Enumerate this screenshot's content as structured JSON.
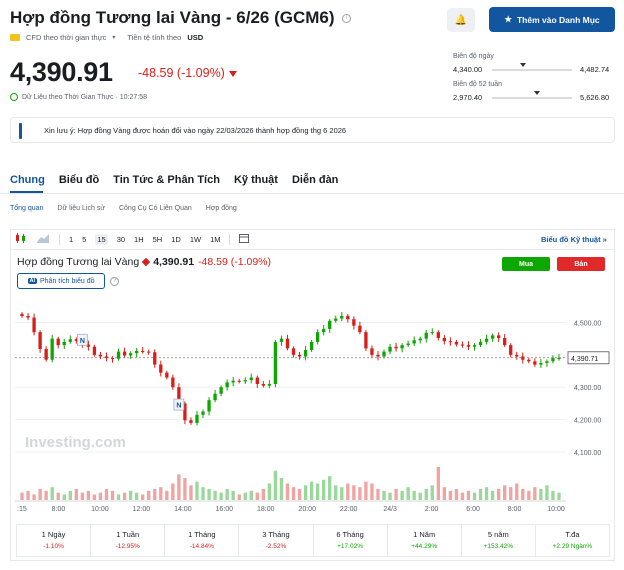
{
  "header": {
    "title": "Hợp đồng Tương lai Vàng - 6/26 (GCM6)",
    "info_glyph": "i",
    "cfd_label": "CFD theo thời gian thực",
    "currency_label": "Tiền tệ tính theo",
    "currency": "USD",
    "watchlist_button": "Thêm vào Danh Mục",
    "star_glyph": "★",
    "alert_glyph": "🔔"
  },
  "quote": {
    "price": "4,390.91",
    "change": "-48.59 (-1.09%)",
    "realtime_label": "Dữ Liệu theo Thời Gian Thực · 10:27:58"
  },
  "ranges": {
    "day_label": "Biên độ ngày",
    "day_low": "4,340.00",
    "day_high": "4,482.74",
    "day_position": 0.35,
    "week52_label": "Biên độ 52 tuần",
    "week52_low": "2,970.40",
    "week52_high": "5,626.80",
    "week52_position": 0.53
  },
  "notice": {
    "text": "Xin lưu ý: Hợp đồng Vàng được hoán đổi vào ngày 22/03/2026 thành hợp đồng thg 6 2026"
  },
  "tabs": [
    "Chung",
    "Biểu đồ",
    "Tin Tức & Phân Tích",
    "Kỹ thuật",
    "Diễn đàn"
  ],
  "subtabs": [
    "Tổng quan",
    "Dữ liệu Lịch sử",
    "Công Cụ Có Liên Quan",
    "Hợp đồng"
  ],
  "toolbar": {
    "intervals": [
      "1",
      "5",
      "15",
      "30",
      "1H",
      "5H",
      "1D",
      "1W",
      "1M"
    ],
    "active_interval": "15",
    "tech_chart_link": "Biểu đồ Kỹ thuật »"
  },
  "instrument": {
    "name": "Hợp đồng Tương lai Vàng",
    "price": "4,390.91",
    "change": "-48.59 (-1.09%)",
    "buy_label": "Mua",
    "sell_label": "Bán",
    "analysis_label": "Phân tích biểu đồ",
    "ai_badge": "AI",
    "help_glyph": "?"
  },
  "chart_data": {
    "type": "candlestick",
    "watermark": "Investing.com",
    "x_ticks": [
      ":15",
      "8:00",
      "10:00",
      "12:00",
      "14:00",
      "16:00",
      "18:00",
      "20:00",
      "22:00",
      "24/3",
      "2:00",
      "6:00",
      "8:00",
      "10:00"
    ],
    "y_ticks": [
      4500,
      4400,
      4300,
      4200,
      4100
    ],
    "y_tick_labels": [
      "4,500.00",
      "4,400.00",
      "4,300.00",
      "4,200.00",
      "4,100.00"
    ],
    "ylim": [
      4060,
      4560
    ],
    "last_price": 4390.91,
    "last_label": "4,390.71",
    "markers": [
      {
        "label": "N",
        "index": 10,
        "price": 4445
      },
      {
        "label": "N",
        "index": 26,
        "price": 4245
      }
    ],
    "closes": [
      4520,
      4515,
      4470,
      4418,
      4385,
      4450,
      4430,
      4440,
      4448,
      4443,
      4432,
      4425,
      4400,
      4395,
      4390,
      4388,
      4410,
      4398,
      4405,
      4412,
      4410,
      4408,
      4370,
      4345,
      4330,
      4300,
      4250,
      4198,
      4190,
      4215,
      4225,
      4260,
      4280,
      4300,
      4315,
      4320,
      4318,
      4322,
      4330,
      4310,
      4305,
      4310,
      4440,
      4450,
      4420,
      4400,
      4395,
      4415,
      4440,
      4470,
      4480,
      4505,
      4512,
      4520,
      4510,
      4490,
      4470,
      4420,
      4400,
      4395,
      4410,
      4425,
      4420,
      4430,
      4435,
      4445,
      4450,
      4468,
      4470,
      4452,
      4442,
      4440,
      4432,
      4430,
      4425,
      4430,
      4440,
      4450,
      4460,
      4452,
      4430,
      4400,
      4395,
      4385,
      4380,
      4370,
      4375,
      4380,
      4390,
      4390
    ],
    "volumes": [
      4,
      5,
      3,
      6,
      5,
      7,
      4,
      3,
      5,
      6,
      4,
      5,
      3,
      4,
      6,
      5,
      3,
      4,
      5,
      4,
      3,
      5,
      6,
      7,
      5,
      9,
      14,
      12,
      8,
      10,
      7,
      6,
      5,
      4,
      6,
      5,
      3,
      4,
      5,
      4,
      6,
      9,
      16,
      12,
      9,
      7,
      6,
      8,
      10,
      9,
      11,
      13,
      8,
      7,
      9,
      8,
      7,
      10,
      9,
      6,
      5,
      4,
      6,
      5,
      7,
      5,
      4,
      6,
      8,
      18,
      7,
      5,
      6,
      4,
      5,
      4,
      6,
      7,
      5,
      6,
      8,
      7,
      9,
      6,
      5,
      7,
      6,
      8,
      5,
      4
    ]
  },
  "performance": [
    {
      "label": "1 Ngày",
      "value": "-1.10%",
      "sign": "neg"
    },
    {
      "label": "1 Tuần",
      "value": "-12.95%",
      "sign": "neg"
    },
    {
      "label": "1 Tháng",
      "value": "-14.84%",
      "sign": "neg"
    },
    {
      "label": "3 Tháng",
      "value": "-2.52%",
      "sign": "neg"
    },
    {
      "label": "6 Tháng",
      "value": "+17.02%",
      "sign": "pos"
    },
    {
      "label": "1 Năm",
      "value": "+44.29%",
      "sign": "pos"
    },
    {
      "label": "5 năm",
      "value": "+153.42%",
      "sign": "pos"
    },
    {
      "label": "T.đa",
      "value": "+2.29 Ngàn%",
      "sign": "pos"
    }
  ],
  "colors": {
    "up": "#0ea600",
    "down": "#d91e18",
    "accent": "#1256a0"
  }
}
